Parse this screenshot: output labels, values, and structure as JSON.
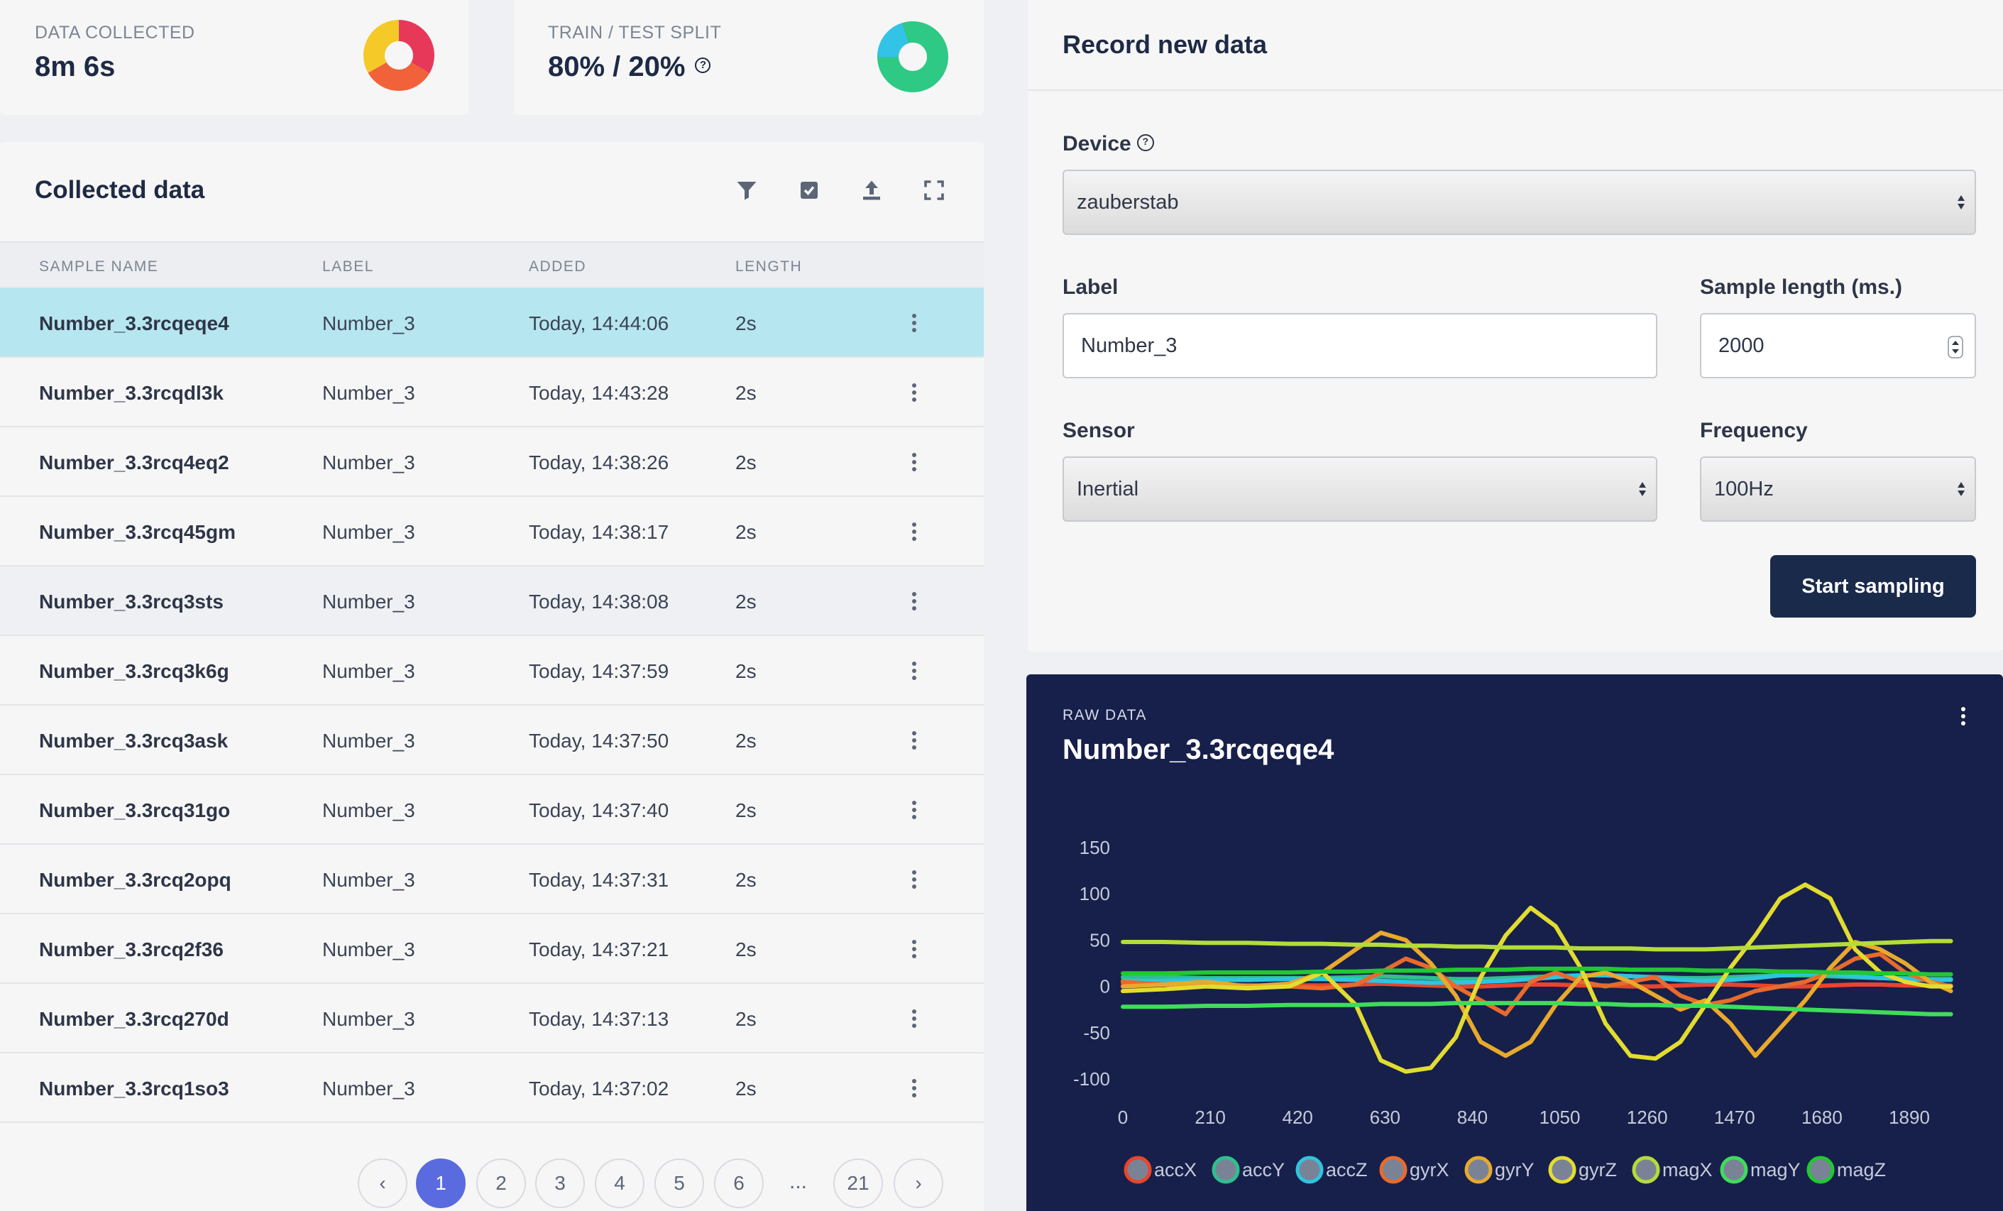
{
  "stats": [
    {
      "label": "DATA COLLECTED",
      "value": "8m 6s"
    },
    {
      "label": "TRAIN / TEST SPLIT",
      "value": "80% / 20%",
      "help": "?"
    }
  ],
  "collected": {
    "title": "Collected data",
    "columns": [
      "SAMPLE NAME",
      "LABEL",
      "ADDED",
      "LENGTH"
    ],
    "rows": [
      {
        "name": "Number_3.3rcqeqe4",
        "label": "Number_3",
        "added": "Today, 14:44:06",
        "length": "2s"
      },
      {
        "name": "Number_3.3rcqdl3k",
        "label": "Number_3",
        "added": "Today, 14:43:28",
        "length": "2s"
      },
      {
        "name": "Number_3.3rcq4eq2",
        "label": "Number_3",
        "added": "Today, 14:38:26",
        "length": "2s"
      },
      {
        "name": "Number_3.3rcq45gm",
        "label": "Number_3",
        "added": "Today, 14:38:17",
        "length": "2s"
      },
      {
        "name": "Number_3.3rcq3sts",
        "label": "Number_3",
        "added": "Today, 14:38:08",
        "length": "2s"
      },
      {
        "name": "Number_3.3rcq3k6g",
        "label": "Number_3",
        "added": "Today, 14:37:59",
        "length": "2s"
      },
      {
        "name": "Number_3.3rcq3ask",
        "label": "Number_3",
        "added": "Today, 14:37:50",
        "length": "2s"
      },
      {
        "name": "Number_3.3rcq31go",
        "label": "Number_3",
        "added": "Today, 14:37:40",
        "length": "2s"
      },
      {
        "name": "Number_3.3rcq2opq",
        "label": "Number_3",
        "added": "Today, 14:37:31",
        "length": "2s"
      },
      {
        "name": "Number_3.3rcq2f36",
        "label": "Number_3",
        "added": "Today, 14:37:21",
        "length": "2s"
      },
      {
        "name": "Number_3.3rcq270d",
        "label": "Number_3",
        "added": "Today, 14:37:13",
        "length": "2s"
      },
      {
        "name": "Number_3.3rcq1so3",
        "label": "Number_3",
        "added": "Today, 14:37:02",
        "length": "2s"
      }
    ],
    "pagination": {
      "prev": "‹",
      "pages": [
        "1",
        "2",
        "3",
        "4",
        "5",
        "6"
      ],
      "ellipsis": "...",
      "last": "21",
      "next": "›",
      "current": "1"
    }
  },
  "record": {
    "title": "Record new data",
    "device_label": "Device",
    "device_value": "zauberstab",
    "label_label": "Label",
    "label_value": "Number_3",
    "length_label": "Sample length (ms.)",
    "length_value": "2000",
    "sensor_label": "Sensor",
    "sensor_value": "Inertial",
    "frequency_label": "Frequency",
    "frequency_value": "100Hz",
    "start_button": "Start sampling"
  },
  "raw": {
    "label": "RAW DATA",
    "sample_name": "Number_3.3rcqeqe4"
  },
  "colors": {
    "accent": "#5a6be0",
    "selected_row": "#b6e6ef",
    "dark_panel": "#17204a",
    "button": "#1a2a4a"
  },
  "chart_data": {
    "type": "line",
    "x_ticks": [
      0,
      210,
      420,
      630,
      840,
      1050,
      1260,
      1470,
      1680,
      1890
    ],
    "y_ticks": [
      150,
      100,
      50,
      0,
      -50,
      -100
    ],
    "xlim": [
      0,
      1990
    ],
    "ylim": [
      -110,
      155
    ],
    "grid": false,
    "legend_position": "bottom",
    "x": [
      0,
      100,
      200,
      300,
      400,
      480,
      560,
      620,
      680,
      740,
      800,
      860,
      920,
      980,
      1040,
      1100,
      1160,
      1220,
      1280,
      1340,
      1400,
      1460,
      1520,
      1580,
      1640,
      1700,
      1760,
      1820,
      1880,
      1940,
      1990
    ],
    "series": [
      {
        "name": "accX",
        "color": "#e8452c",
        "values": [
          3,
          2,
          2,
          1,
          1,
          1,
          2,
          3,
          2,
          1,
          0,
          0,
          1,
          2,
          2,
          1,
          1,
          0,
          0,
          1,
          2,
          2,
          1,
          0,
          0,
          1,
          2,
          2,
          1,
          1,
          1
        ]
      },
      {
        "name": "accY",
        "color": "#2fbf8f",
        "values": [
          10,
          10,
          9,
          9,
          9,
          9,
          10,
          11,
          10,
          9,
          8,
          8,
          9,
          10,
          11,
          12,
          12,
          11,
          10,
          9,
          9,
          10,
          11,
          12,
          12,
          11,
          10,
          9,
          9,
          8,
          8
        ]
      },
      {
        "name": "accZ",
        "color": "#2fc4e0",
        "values": [
          6,
          6,
          7,
          7,
          8,
          8,
          7,
          6,
          5,
          4,
          4,
          5,
          6,
          8,
          10,
          12,
          12,
          11,
          9,
          7,
          6,
          7,
          9,
          12,
          14,
          13,
          11,
          9,
          8,
          7,
          7
        ]
      },
      {
        "name": "gyrX",
        "color": "#e86a2c",
        "values": [
          5,
          2,
          0,
          1,
          0,
          -2,
          2,
          15,
          30,
          20,
          0,
          -15,
          -30,
          5,
          15,
          5,
          0,
          5,
          10,
          -10,
          -20,
          -15,
          -5,
          0,
          5,
          15,
          30,
          35,
          15,
          5,
          0
        ]
      },
      {
        "name": "gyrY",
        "color": "#e8a92c",
        "values": [
          0,
          2,
          5,
          0,
          3,
          15,
          40,
          58,
          50,
          25,
          -10,
          -60,
          -75,
          -60,
          -20,
          10,
          15,
          5,
          -10,
          -25,
          -15,
          -40,
          -75,
          -45,
          -15,
          20,
          48,
          40,
          25,
          5,
          -5
        ]
      },
      {
        "name": "gyrZ",
        "color": "#e2dc30",
        "values": [
          -5,
          -3,
          0,
          -2,
          0,
          15,
          -20,
          -80,
          -92,
          -88,
          -55,
          10,
          55,
          85,
          65,
          20,
          -40,
          -75,
          -78,
          -60,
          -20,
          20,
          55,
          95,
          110,
          95,
          40,
          15,
          5,
          0,
          0
        ]
      },
      {
        "name": "magX",
        "color": "#b4dc3a",
        "values": [
          48,
          48,
          47,
          47,
          46,
          46,
          45,
          45,
          44,
          44,
          43,
          43,
          42,
          42,
          42,
          41,
          41,
          41,
          40,
          40,
          40,
          41,
          42,
          43,
          44,
          45,
          46,
          47,
          48,
          49,
          49
        ]
      },
      {
        "name": "magY",
        "color": "#3fdc5a",
        "values": [
          -22,
          -22,
          -21,
          -21,
          -20,
          -20,
          -20,
          -19,
          -19,
          -19,
          -18,
          -18,
          -18,
          -18,
          -18,
          -19,
          -19,
          -20,
          -20,
          -21,
          -21,
          -22,
          -23,
          -24,
          -25,
          -26,
          -27,
          -28,
          -29,
          -30,
          -30
        ]
      },
      {
        "name": "magZ",
        "color": "#22c832",
        "values": [
          14,
          14,
          15,
          15,
          15,
          16,
          16,
          17,
          17,
          17,
          18,
          18,
          18,
          19,
          19,
          19,
          19,
          18,
          18,
          18,
          17,
          17,
          17,
          16,
          16,
          15,
          15,
          14,
          14,
          13,
          13
        ]
      }
    ]
  }
}
